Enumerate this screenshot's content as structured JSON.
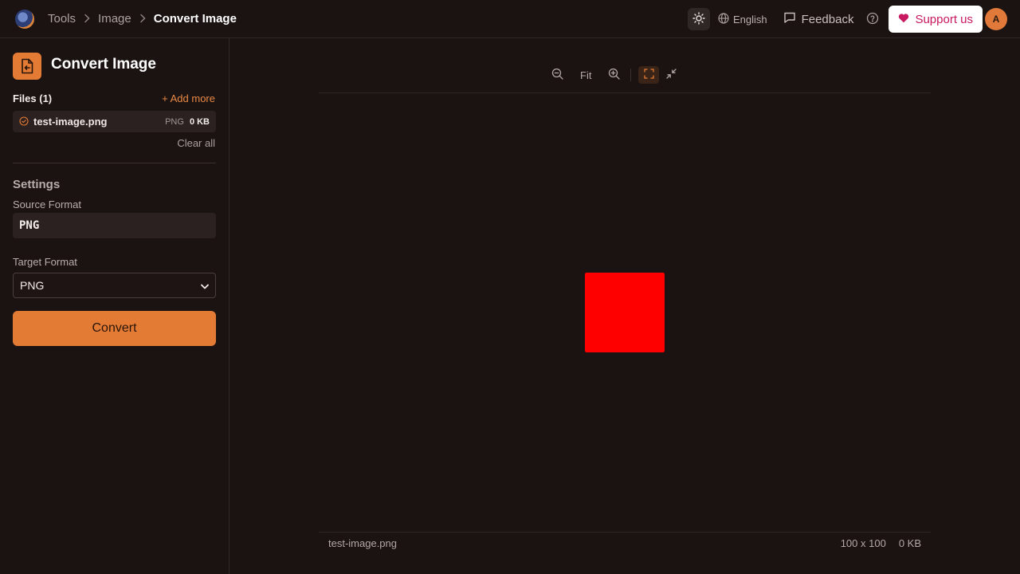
{
  "breadcrumb": {
    "items": [
      "Tools",
      "Image"
    ],
    "current": "Convert Image"
  },
  "header": {
    "language": "English",
    "feedback_label": "Feedback",
    "support_label": "Support us",
    "avatar_initial": "A",
    "icons": [
      "sun-icon",
      "globe-icon",
      "message-icon",
      "help-icon",
      "heart-icon"
    ],
    "support_color": "#c8185f"
  },
  "sidebar": {
    "tool_title": "Convert Image",
    "files_label": "Files (1)",
    "add_more_label": "+ Add more",
    "files": [
      {
        "name": "test-image.png",
        "type": "PNG",
        "size": "0 KB"
      }
    ],
    "clear_all_label": "Clear all",
    "settings_title": "Settings",
    "source_format_label": "Source Format",
    "source_format_value": "PNG",
    "target_format_label": "Target Format",
    "target_format_value": "PNG",
    "convert_label": "Convert",
    "accent_color": "#e37b35"
  },
  "preview": {
    "fit_label": "Fit",
    "image_color": "#ff0000",
    "file_name": "test-image.png",
    "dimensions": "100 x 100",
    "size": "0 KB"
  }
}
